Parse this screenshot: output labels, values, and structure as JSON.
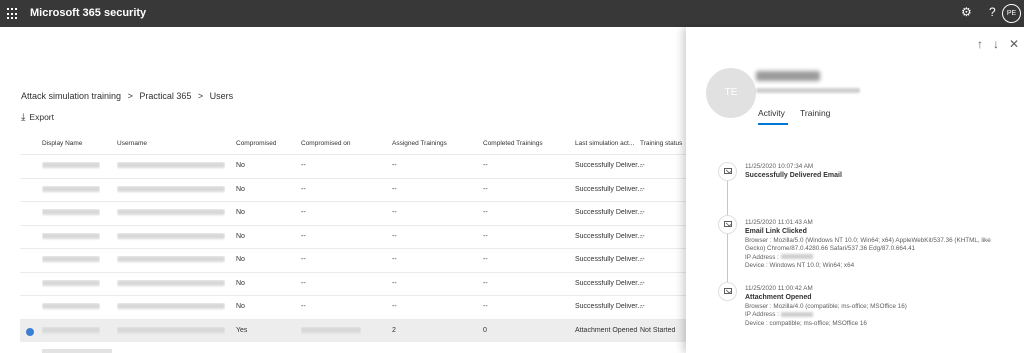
{
  "topbar": {
    "app_title": "Microsoft 365 security",
    "user_initials": "PE"
  },
  "breadcrumb": [
    "Attack simulation training",
    ">",
    "Practical 365",
    ">",
    "Users"
  ],
  "toolbar": {
    "export_label": "Export"
  },
  "table": {
    "headers": [
      "Display Name",
      "Username",
      "Compromised",
      "Compromised on",
      "Assigned Trainings",
      "Completed Trainings",
      "Last simulation act...",
      "Training status"
    ],
    "rows": [
      {
        "compromised": "No",
        "compromised_on": "--",
        "assigned": "--",
        "completed": "--",
        "last_activity": "Successfully Deliver...",
        "training_status": "--"
      },
      {
        "compromised": "No",
        "compromised_on": "--",
        "assigned": "--",
        "completed": "--",
        "last_activity": "Successfully Deliver...",
        "training_status": "--"
      },
      {
        "compromised": "No",
        "compromised_on": "--",
        "assigned": "--",
        "completed": "--",
        "last_activity": "Successfully Deliver...",
        "training_status": "--"
      },
      {
        "compromised": "No",
        "compromised_on": "--",
        "assigned": "--",
        "completed": "--",
        "last_activity": "Successfully Deliver...",
        "training_status": "--"
      },
      {
        "compromised": "No",
        "compromised_on": "--",
        "assigned": "--",
        "completed": "--",
        "last_activity": "Successfully Deliver...",
        "training_status": "--"
      },
      {
        "compromised": "No",
        "compromised_on": "--",
        "assigned": "--",
        "completed": "--",
        "last_activity": "Successfully Deliver...",
        "training_status": "--"
      },
      {
        "compromised": "No",
        "compromised_on": "--",
        "assigned": "--",
        "completed": "--",
        "last_activity": "Successfully Deliver...",
        "training_status": "--"
      },
      {
        "compromised": "Yes",
        "compromised_on": "",
        "assigned": "2",
        "completed": "0",
        "last_activity": "Attachment Opened",
        "training_status": "Not Started",
        "selected": true
      }
    ]
  },
  "panel": {
    "avatar_initials": "TE",
    "tabs": [
      "Activity",
      "Training"
    ],
    "events": [
      {
        "time": "11/25/2020 10:07:34 AM",
        "title": "Successfully Delivered Email"
      },
      {
        "time": "11/25/2020 11:01:43 AM",
        "title": "Email Link Clicked",
        "browser": "Browser : Mozilla/5.0 (Windows NT 10.0; Win64; x64) AppleWebKit/537.36 (KHTML, like Gecko) Chrome/87.0.4280.66 Safari/537.36 Edg/87.0.664.41",
        "ip_label": "IP Address :",
        "device": "Device : Windows NT 10.0; Win64; x64"
      },
      {
        "time": "11/25/2020 11:00:42 AM",
        "title": "Attachment Opened",
        "browser": "Browser : Mozilla/4.0 (compatible; ms-office; MSOffice 16)",
        "ip_label": "IP Address :",
        "device": "Device : compatible; ms-office; MSOffice 16"
      }
    ]
  },
  "icons": {
    "settings": "gear-icon",
    "help": "question-icon",
    "up": "arrow-up-icon",
    "down": "arrow-down-icon",
    "close": "close-icon"
  },
  "colors": {
    "topbar": "#383838",
    "accent": "#0078d4",
    "selected_row": "#ededed"
  }
}
